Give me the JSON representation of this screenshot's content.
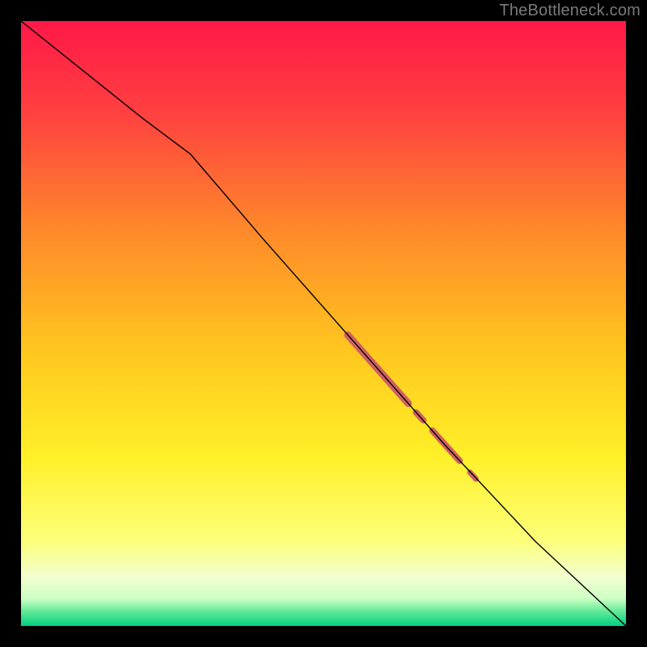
{
  "watermark": "TheBottleneck.com",
  "colors": {
    "frame_bg": "#000000",
    "line": "#000000",
    "blob": "#cf6161",
    "watermark": "#7a7a7a"
  },
  "chart_data": {
    "type": "line",
    "title": "",
    "xlabel": "",
    "ylabel": "",
    "xlim": [
      0,
      100
    ],
    "ylim": [
      0,
      100
    ],
    "gradient_stops": [
      {
        "offset": 0,
        "color": "#ff1848"
      },
      {
        "offset": 0.15,
        "color": "#ff4040"
      },
      {
        "offset": 0.35,
        "color": "#ff8a2a"
      },
      {
        "offset": 0.55,
        "color": "#ffc81e"
      },
      {
        "offset": 0.72,
        "color": "#fff028"
      },
      {
        "offset": 0.86,
        "color": "#fcff7a"
      },
      {
        "offset": 0.92,
        "color": "#f2ffd0"
      },
      {
        "offset": 0.955,
        "color": "#ccffc4"
      },
      {
        "offset": 0.975,
        "color": "#66ea99"
      },
      {
        "offset": 1.0,
        "color": "#00d080"
      }
    ],
    "series": [
      {
        "name": "main-curve",
        "x": [
          0,
          10,
          20,
          28,
          40,
          55,
          70,
          85,
          100
        ],
        "y": [
          100,
          92,
          84,
          78,
          64,
          47,
          30,
          14,
          0
        ]
      }
    ],
    "highlight_segments": [
      {
        "x0": 54,
        "y0": 48.1,
        "x1": 64,
        "y1": 36.8,
        "width": 9
      },
      {
        "x0": 65.3,
        "y0": 35.3,
        "x1": 66.5,
        "y1": 34.0,
        "width": 8
      },
      {
        "x0": 68,
        "y0": 32.3,
        "x1": 72.5,
        "y1": 27.3,
        "width": 8
      },
      {
        "x0": 74.2,
        "y0": 25.4,
        "x1": 75.2,
        "y1": 24.3,
        "width": 7
      }
    ]
  }
}
